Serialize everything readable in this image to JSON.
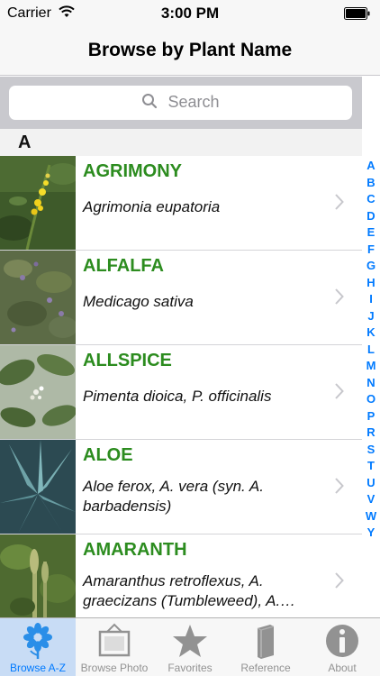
{
  "status_bar": {
    "carrier": "Carrier",
    "time": "3:00 PM"
  },
  "nav": {
    "title": "Browse by Plant Name"
  },
  "search": {
    "placeholder": "Search"
  },
  "section": {
    "letter": "A"
  },
  "plants": [
    {
      "name": "AGRIMONY",
      "scientific": "Agrimonia eupatoria",
      "icon": "agrimony-photo"
    },
    {
      "name": "ALFALFA",
      "scientific": "Medicago sativa",
      "icon": "alfalfa-photo"
    },
    {
      "name": "ALLSPICE",
      "scientific": "Pimenta dioica, P. officinalis",
      "icon": "allspice-photo"
    },
    {
      "name": "ALOE",
      "scientific": "Aloe ferox, A. vera (syn. A.\nbarbadensis)",
      "icon": "aloe-photo"
    },
    {
      "name": "AMARANTH",
      "scientific": "Amaranthus retroflexus, A.\ngraecizans (Tumbleweed), A.…",
      "icon": "amaranth-photo"
    }
  ],
  "index_letters": [
    "A",
    "B",
    "C",
    "D",
    "E",
    "F",
    "G",
    "H",
    "I",
    "J",
    "K",
    "L",
    "M",
    "N",
    "O",
    "P",
    "R",
    "S",
    "T",
    "U",
    "V",
    "W",
    "Y"
  ],
  "tabs": [
    {
      "label": "Browse A-Z",
      "icon": "flower-icon",
      "active": true
    },
    {
      "label": "Browse Photo",
      "icon": "photo-frame-icon",
      "active": false
    },
    {
      "label": "Favorites",
      "icon": "star-icon",
      "active": false
    },
    {
      "label": "Reference",
      "icon": "book-icon",
      "active": false
    },
    {
      "label": "About",
      "icon": "info-icon",
      "active": false
    }
  ],
  "colors": {
    "accent": "#007aff",
    "plant_name": "#2c8c1f",
    "tab_inactive": "#929292"
  }
}
